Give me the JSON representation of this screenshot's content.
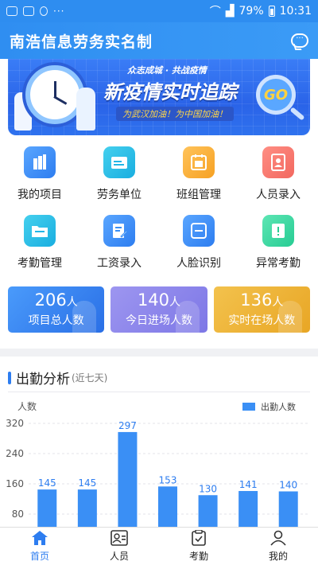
{
  "status_bar": {
    "battery": "79%",
    "time": "10:31",
    "dots": "···"
  },
  "app": {
    "title": "南浩信息劳务实名制"
  },
  "banner": {
    "slogan": "众志成城 · 共战疫情",
    "title": "新疫情实时追踪",
    "subtitle": "为武汉加油！为中国加油！",
    "go": "GO"
  },
  "menu": {
    "row1": [
      {
        "label": "我的项目",
        "icon": "building-icon",
        "color": "#3a8ff5"
      },
      {
        "label": "劳务单位",
        "icon": "card-icon",
        "color": "#22b6e6"
      },
      {
        "label": "班组管理",
        "icon": "calendar-icon",
        "color": "#f7ad36"
      },
      {
        "label": "人员录入",
        "icon": "user-card-icon",
        "color": "#f47a70"
      }
    ],
    "row2": [
      {
        "label": "考勤管理",
        "icon": "folder-icon",
        "color": "#22b6e6"
      },
      {
        "label": "工资录入",
        "icon": "edit-doc-icon",
        "color": "#3a8ff5"
      },
      {
        "label": "人脸识别",
        "icon": "scan-icon",
        "color": "#3a8ff5"
      },
      {
        "label": "异常考勤",
        "icon": "alert-doc-icon",
        "color": "#2fd19b"
      }
    ]
  },
  "stats": [
    {
      "value": "206",
      "unit": "人",
      "label": "项目总人数"
    },
    {
      "value": "140",
      "unit": "人",
      "label": "今日进场人数"
    },
    {
      "value": "136",
      "unit": "人",
      "label": "实时在场人数"
    }
  ],
  "section": {
    "title": "出勤分析",
    "subtitle": "(近七天)"
  },
  "chart_data": {
    "type": "bar",
    "ylabel": "人数",
    "legend": "出勤人数",
    "legend_position": "top-right",
    "yticks": [
      80,
      160,
      240,
      320
    ],
    "ylim_visible": [
      60,
      330
    ],
    "values": [
      145,
      145,
      297,
      153,
      130,
      141,
      140
    ],
    "bar_color": "#3a8ff5",
    "grid": true
  },
  "tabbar": {
    "items": [
      {
        "label": "首页",
        "active": true
      },
      {
        "label": "人员",
        "active": false
      },
      {
        "label": "考勤",
        "active": false
      },
      {
        "label": "我的",
        "active": false
      }
    ]
  }
}
